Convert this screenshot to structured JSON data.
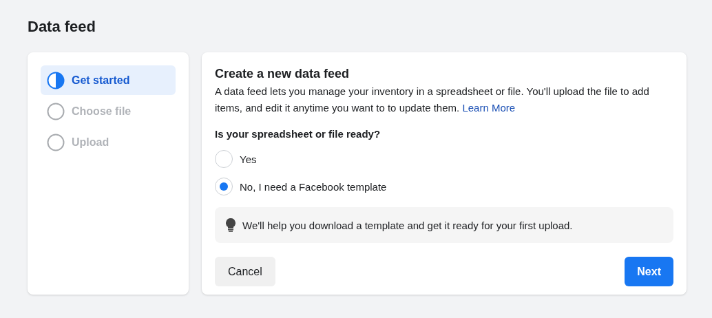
{
  "page_title": "Data feed",
  "steps": [
    {
      "label": "Get started",
      "selected": true
    },
    {
      "label": "Choose file",
      "selected": false
    },
    {
      "label": "Upload",
      "selected": false
    }
  ],
  "panel": {
    "title": "Create a new data feed",
    "description": "A data feed lets you manage your inventory in a spreadsheet or file. You'll upload the file to add items, and edit it anytime you want to to update them.",
    "link": "Learn More",
    "question": "Is your spreadsheet or file ready?",
    "options": [
      {
        "label": "Yes",
        "selected": false
      },
      {
        "label": "No, I need a Facebook template",
        "selected": true
      }
    ],
    "tip": "We'll help you download a template and get it ready for your first upload.",
    "buttons": [
      {
        "label": "Cancel",
        "kind": "secondary"
      },
      {
        "label": "Next",
        "kind": "primary"
      }
    ]
  }
}
